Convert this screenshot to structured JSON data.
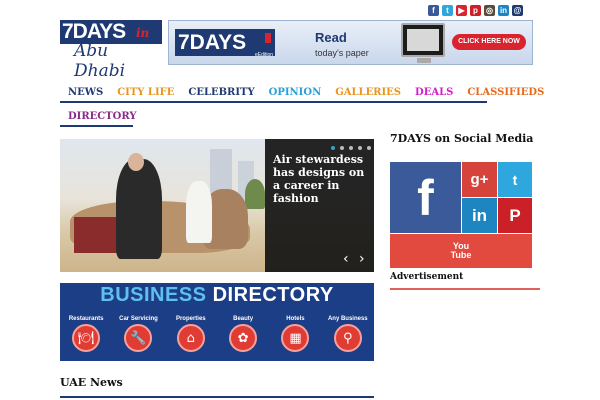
{
  "top_social": [
    {
      "icon": "facebook-icon",
      "glyph": "f",
      "color": "#3b5998"
    },
    {
      "icon": "twitter-icon",
      "glyph": "t",
      "color": "#2ea6de"
    },
    {
      "icon": "youtube-icon",
      "glyph": "▶",
      "color": "#d9232e"
    },
    {
      "icon": "pinterest-icon",
      "glyph": "p",
      "color": "#cb2027"
    },
    {
      "icon": "instagram-icon",
      "glyph": "◎",
      "color": "#5a4b3e"
    },
    {
      "icon": "linkedin-icon",
      "glyph": "in",
      "color": "#1d85c0"
    },
    {
      "icon": "email-icon",
      "glyph": "@",
      "color": "#1f3a72"
    }
  ],
  "logo": {
    "main": "7DAYS",
    "in": "in",
    "city": "Abu Dhabi"
  },
  "banner": {
    "brand": "7DAYS",
    "edition": "eEdition",
    "read": "Read",
    "sub": "today's paper",
    "cta": "CLICK HERE NOW"
  },
  "nav": [
    {
      "label": "NEWS",
      "color": "#1f3a72"
    },
    {
      "label": "CITY LIFE",
      "color": "#e8951e"
    },
    {
      "label": "CELEBRITY",
      "color": "#1f3a72"
    },
    {
      "label": "OPINION",
      "color": "#2aa0d8"
    },
    {
      "label": "GALLERIES",
      "color": "#e8951e"
    },
    {
      "label": "DEALS",
      "color": "#d21ec8"
    },
    {
      "label": "CLASSIFIEDS",
      "color": "#e86a1e"
    }
  ],
  "nav_row2": {
    "label": "DIRECTORY",
    "color": "#8a2a8a"
  },
  "hero": {
    "caption": "Air stewardess has designs on a career in fashion",
    "prev": "‹",
    "next": "›"
  },
  "business_directory": {
    "title_part1": "BUSINESS",
    "title_part2": "DIRECTORY",
    "categories": [
      {
        "label": "Restaurants",
        "icon": "restaurant-icon",
        "glyph": "🍽"
      },
      {
        "label": "Car Servicing",
        "icon": "car-servicing-icon",
        "glyph": "🔧"
      },
      {
        "label": "Properties",
        "icon": "properties-icon",
        "glyph": "⌂"
      },
      {
        "label": "Beauty",
        "icon": "beauty-icon",
        "glyph": "✿"
      },
      {
        "label": "Hotels",
        "icon": "hotels-icon",
        "glyph": "▦"
      },
      {
        "label": "Any Business",
        "icon": "search-icon",
        "glyph": "⚲"
      }
    ]
  },
  "uae_news": {
    "title": "UAE News"
  },
  "sidebar": {
    "social_title": "7DAYS on Social Media",
    "tiles": {
      "facebook": "f",
      "googleplus": "g+",
      "twitter": "t",
      "linkedin": "in",
      "pinterest": "P",
      "youtube_top": "You",
      "youtube_bottom": "Tube"
    },
    "advertisement": "Advertisement"
  }
}
